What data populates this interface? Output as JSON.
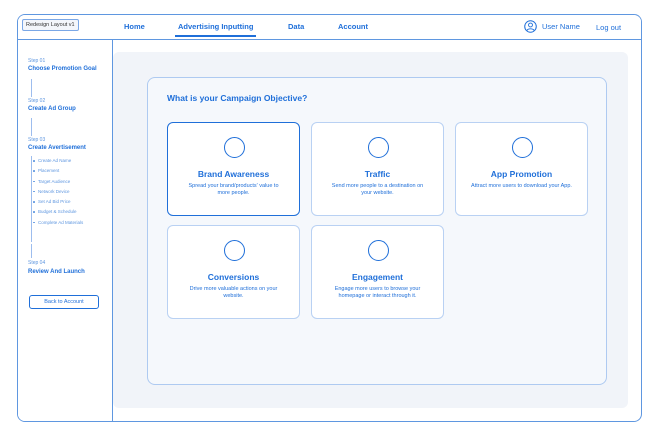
{
  "app": {
    "logo_text": "Redesign Layout v1"
  },
  "nav": {
    "items": [
      "Home",
      "Advertising Inputting",
      "Data",
      "Account"
    ],
    "active_index": 1,
    "user_name": "User Name",
    "logout_label": "Log out"
  },
  "sidebar": {
    "steps": [
      {
        "label": "Step 01",
        "title": "Choose Promotion Goal"
      },
      {
        "label": "Step 02",
        "title": "Create Ad Group"
      },
      {
        "label": "Step 03",
        "title": "Create Avertisement"
      },
      {
        "label": "Step 04",
        "title": "Review And Launch"
      }
    ],
    "substeps": [
      "Create Ad Name",
      "Placement",
      "Target Audience",
      "Network Device",
      "Set Ad Bid Price",
      "Budget & Schedule",
      "Complete Ad Materials"
    ],
    "back_button": "Back to Account"
  },
  "main": {
    "title": "What is your Campaign Objective?",
    "cards": [
      {
        "title": "Brand Awareness",
        "desc": "Spread your brand/products' value to more people."
      },
      {
        "title": "Traffic",
        "desc": "Send more people to a destination on your website."
      },
      {
        "title": "App Promotion",
        "desc": "Attract more users to download your App."
      },
      {
        "title": "Conversions",
        "desc": "Drive more valuable actions on your website."
      },
      {
        "title": "Engagement",
        "desc": "Engage more users to browse your homepage or interact through it."
      }
    ],
    "selected_card": 0
  },
  "colors": {
    "accent": "#1f6fd9",
    "border": "#5f97e0",
    "panel": "#f5f8fc"
  }
}
